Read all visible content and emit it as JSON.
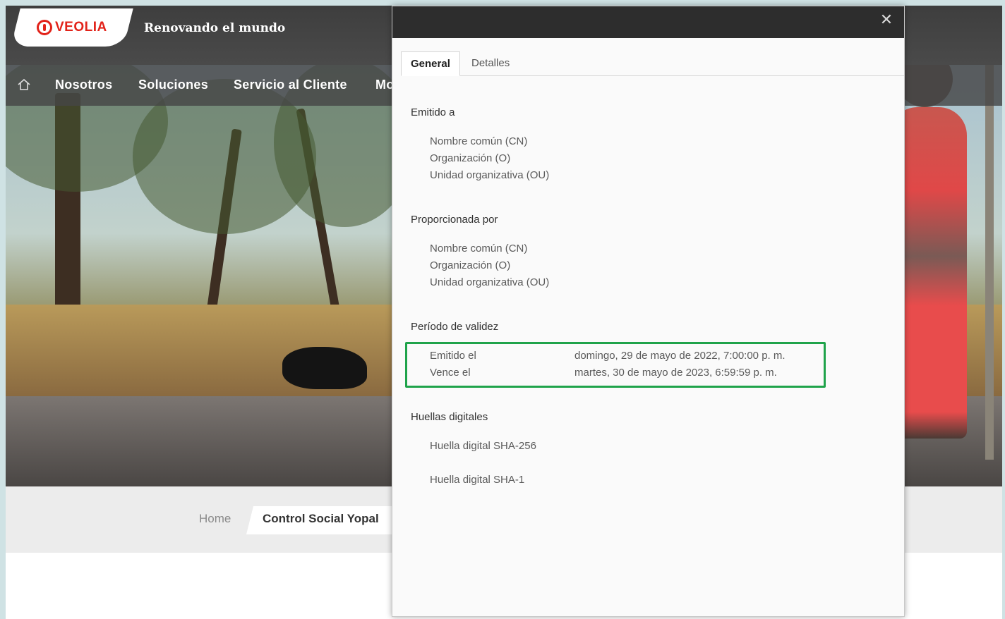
{
  "site": {
    "logo_text": "VEOLIA",
    "tagline": "Renovando el mundo",
    "nav": [
      "Nosotros",
      "Soluciones",
      "Servicio al Cliente",
      "Mo"
    ],
    "breadcrumb": {
      "home": "Home",
      "current": "Control Social Yopal"
    }
  },
  "dialog": {
    "close_glyph": "✕",
    "tabs": {
      "general": "General",
      "detalles": "Detalles"
    },
    "issued_to": {
      "title": "Emitido a",
      "fields": [
        "Nombre común (CN)",
        "Organización (O)",
        "Unidad organizativa (OU)"
      ]
    },
    "issued_by": {
      "title": "Proporcionada por",
      "fields": [
        "Nombre común (CN)",
        "Organización (O)",
        "Unidad organizativa (OU)"
      ]
    },
    "validity": {
      "title": "Período de validez",
      "issued_label": "Emitido el",
      "issued_value": "domingo, 29 de mayo de 2022, 7:00:00 p. m.",
      "expires_label": "Vence el",
      "expires_value": "martes, 30 de mayo de 2023, 6:59:59 p. m."
    },
    "fingerprints": {
      "title": "Huellas digitales",
      "sha256": "Huella digital SHA-256",
      "sha1": "Huella digital SHA-1"
    }
  },
  "colors": {
    "brand_red": "#e2231a",
    "highlight_green": "#1fa34a",
    "titlebar": "#2d2d2d"
  }
}
